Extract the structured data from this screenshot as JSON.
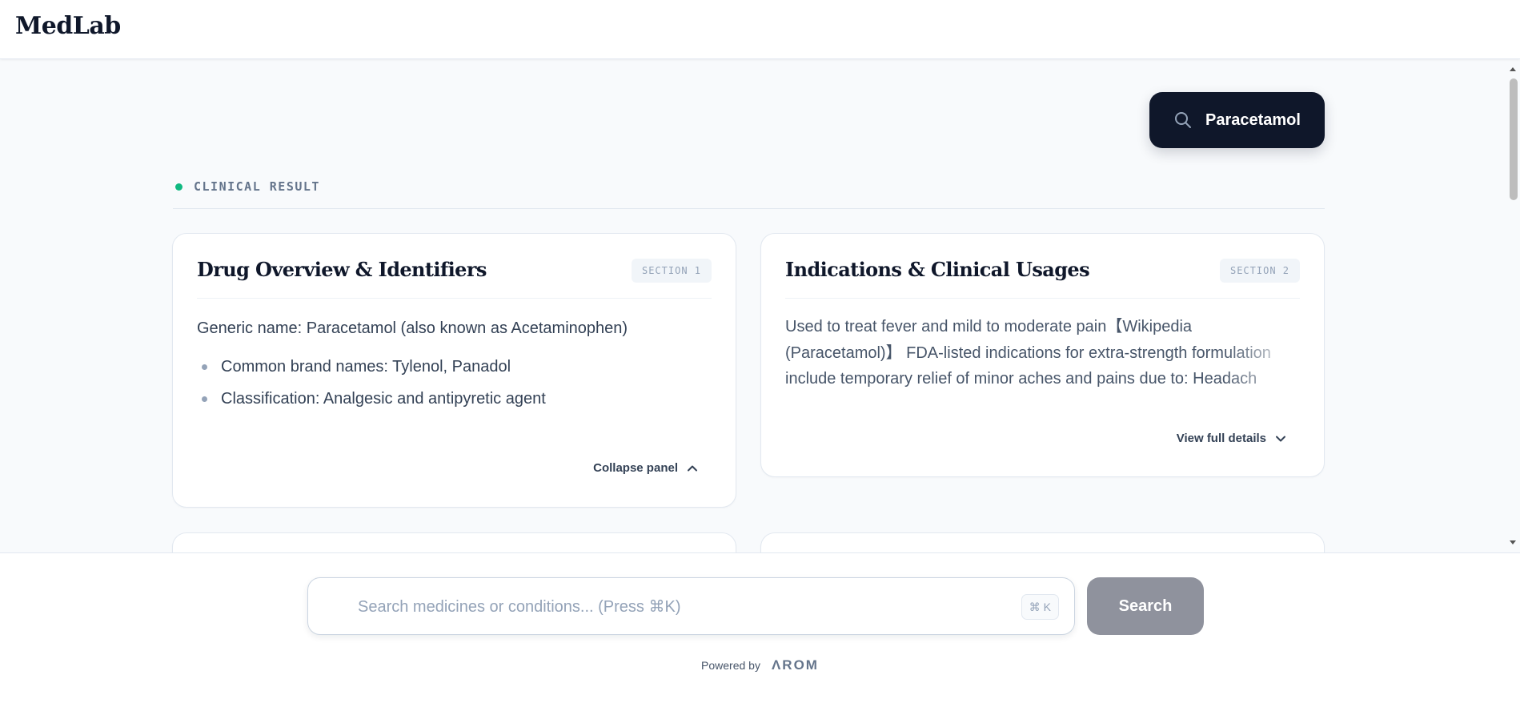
{
  "app": {
    "name": "MedLab"
  },
  "query": {
    "text": "Paracetamol",
    "icon": "search-icon"
  },
  "result_label": "CLINICAL RESULT",
  "cards": [
    {
      "title": "Drug Overview & Identifiers",
      "badge": "SECTION 1",
      "text": "Generic name: Paracetamol (also known as Acetaminophen)",
      "bullets": [
        "Common brand names: Tylenol, Panadol",
        "Classification: Analgesic and antipyretic agent"
      ],
      "toggle_label": "Collapse panel",
      "toggle_icon": "chevron-up-icon"
    },
    {
      "title": "Indications & Clinical Usages",
      "badge": "SECTION 2",
      "text": "Used to treat fever and mild to moderate pain【Wikipedia (Paracetamol)】 FDA-listed indications for extra-strength formulation include temporary relief of minor aches and pains due to: Headach",
      "toggle_label": "View full details",
      "toggle_icon": "chevron-down-icon"
    }
  ],
  "search": {
    "placeholder": "Search medicines or conditions... (Press ⌘K)",
    "value": "",
    "shortcut": "⌘ K",
    "button_label": "Search"
  },
  "footer": {
    "powered_by": "Powered by",
    "brand": "ΛROM"
  },
  "colors": {
    "accent_dark": "#0f172a",
    "status_dot": "#10b981",
    "search_button": "#8f929d"
  }
}
